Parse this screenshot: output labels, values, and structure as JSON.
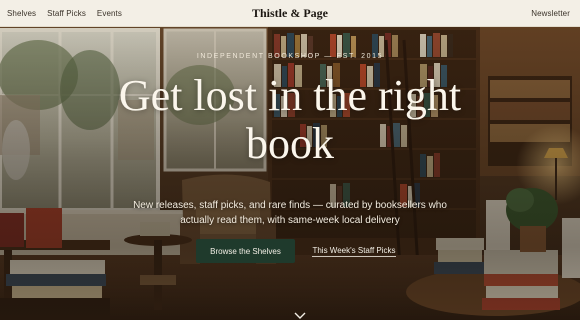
{
  "nav": {
    "links": [
      {
        "label": "Shelves"
      },
      {
        "label": "Staff Picks"
      },
      {
        "label": "Events"
      }
    ],
    "brand": "Thistle & Page",
    "newsletter_label": "Newsletter"
  },
  "hero": {
    "eyebrow": "INDEPENDENT BOOKSHOP — EST. 2015",
    "headline": "Get lost in the right book",
    "subtext": "New releases, staff picks, and rare finds — curated by booksellers who actually read them, with same-week local delivery",
    "primary_cta": "Browse the Shelves",
    "secondary_cta": "This Week's Staff Picks",
    "scroll_icon": "chevron-down-icon"
  },
  "colors": {
    "nav_background": "#f3efe6",
    "primary_button": "#1f3a2c",
    "hero_text": "#fbf6ec"
  }
}
